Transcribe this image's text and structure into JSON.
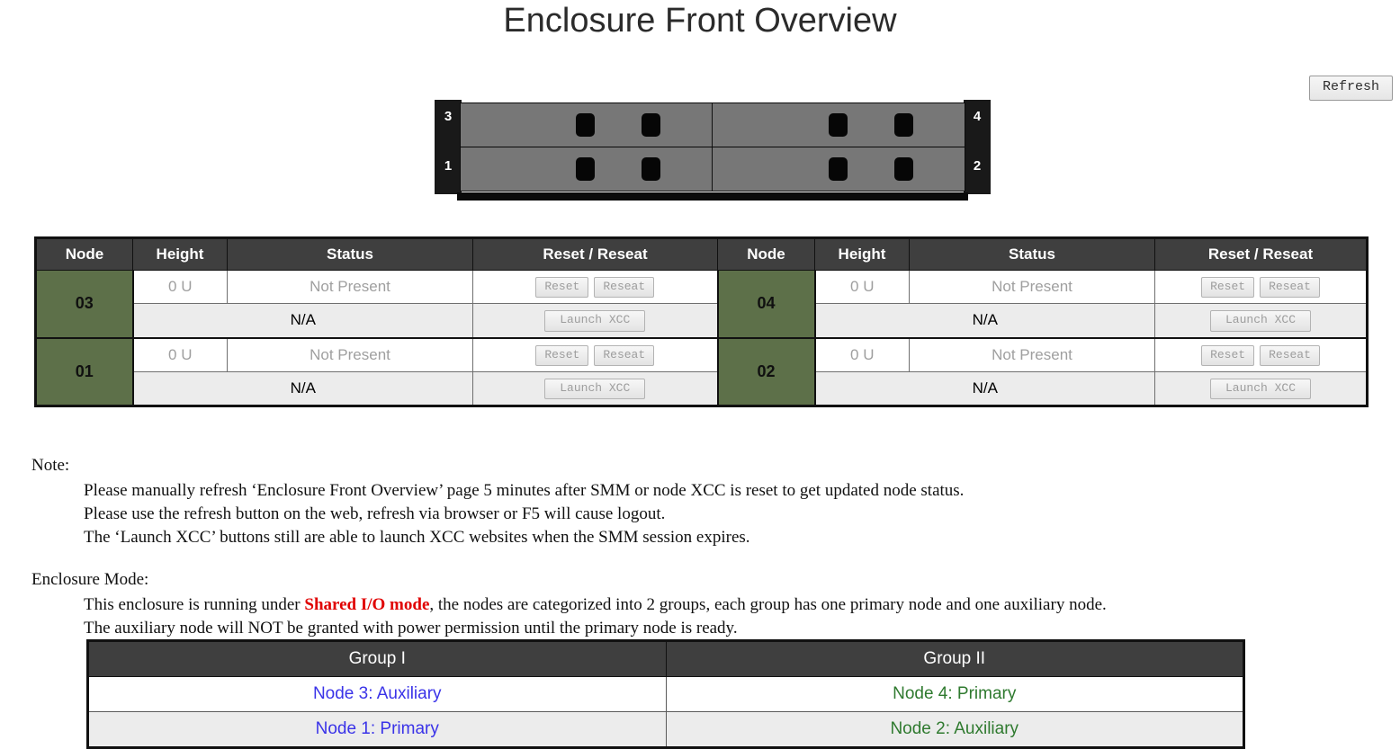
{
  "page": {
    "title": "Enclosure Front Overview"
  },
  "toolbar": {
    "refresh_label": "Refresh"
  },
  "enclosure_graphic": {
    "bays": [
      {
        "rail_side": "left",
        "number": "3"
      },
      {
        "rail_side": "right",
        "number": "4"
      },
      {
        "rail_side": "left",
        "number": "1"
      },
      {
        "rail_side": "right",
        "number": "2"
      }
    ]
  },
  "node_table": {
    "headers": [
      "Node",
      "Height",
      "Status",
      "Reset / Reseat"
    ],
    "groups": [
      {
        "rows": [
          {
            "node": "03",
            "height": "0 U",
            "status": "Not Present",
            "reset_label": "Reset",
            "reseat_label": "Reseat",
            "xcc_status": "N/A",
            "launch_label": "Launch XCC"
          },
          {
            "node": "01",
            "height": "0 U",
            "status": "Not Present",
            "reset_label": "Reset",
            "reseat_label": "Reseat",
            "xcc_status": "N/A",
            "launch_label": "Launch XCC"
          }
        ]
      },
      {
        "rows": [
          {
            "node": "04",
            "height": "0 U",
            "status": "Not Present",
            "reset_label": "Reset",
            "reseat_label": "Reseat",
            "xcc_status": "N/A",
            "launch_label": "Launch XCC"
          },
          {
            "node": "02",
            "height": "0 U",
            "status": "Not Present",
            "reset_label": "Reset",
            "reseat_label": "Reseat",
            "xcc_status": "N/A",
            "launch_label": "Launch XCC"
          }
        ]
      }
    ]
  },
  "note": {
    "heading": "Note:",
    "lines": [
      "Please manually refresh ‘Enclosure Front Overview’ page 5 minutes after SMM or node XCC is reset to get updated node status.",
      "Please use the refresh button on the web, refresh via browser or F5 will cause logout.",
      "The ‘Launch XCC’ buttons still are able to launch XCC websites when the SMM session expires."
    ]
  },
  "enclosure_mode": {
    "heading": "Enclosure Mode:",
    "line1_before": "This enclosure is running under ",
    "line1_highlight": "Shared I/O mode",
    "line1_after": ", the nodes are categorized into 2 groups, each group has one primary node and one auxiliary node.",
    "line2": "The auxiliary node will NOT be granted with power permission until the primary node is ready."
  },
  "group_table": {
    "headers": [
      "Group I",
      "Group II"
    ],
    "rows": [
      {
        "group1": "Node 3: Auxiliary",
        "group2": "Node 4: Primary"
      },
      {
        "group1": "Node 1: Primary",
        "group2": "Node 2: Auxiliary"
      }
    ]
  },
  "colors": {
    "header_bg": "#3f3f3f",
    "node_cell_bg": "#5d7049",
    "group1_text": "#3a33e8",
    "group2_text": "#2f7a2f",
    "highlight_red": "#e00000"
  }
}
